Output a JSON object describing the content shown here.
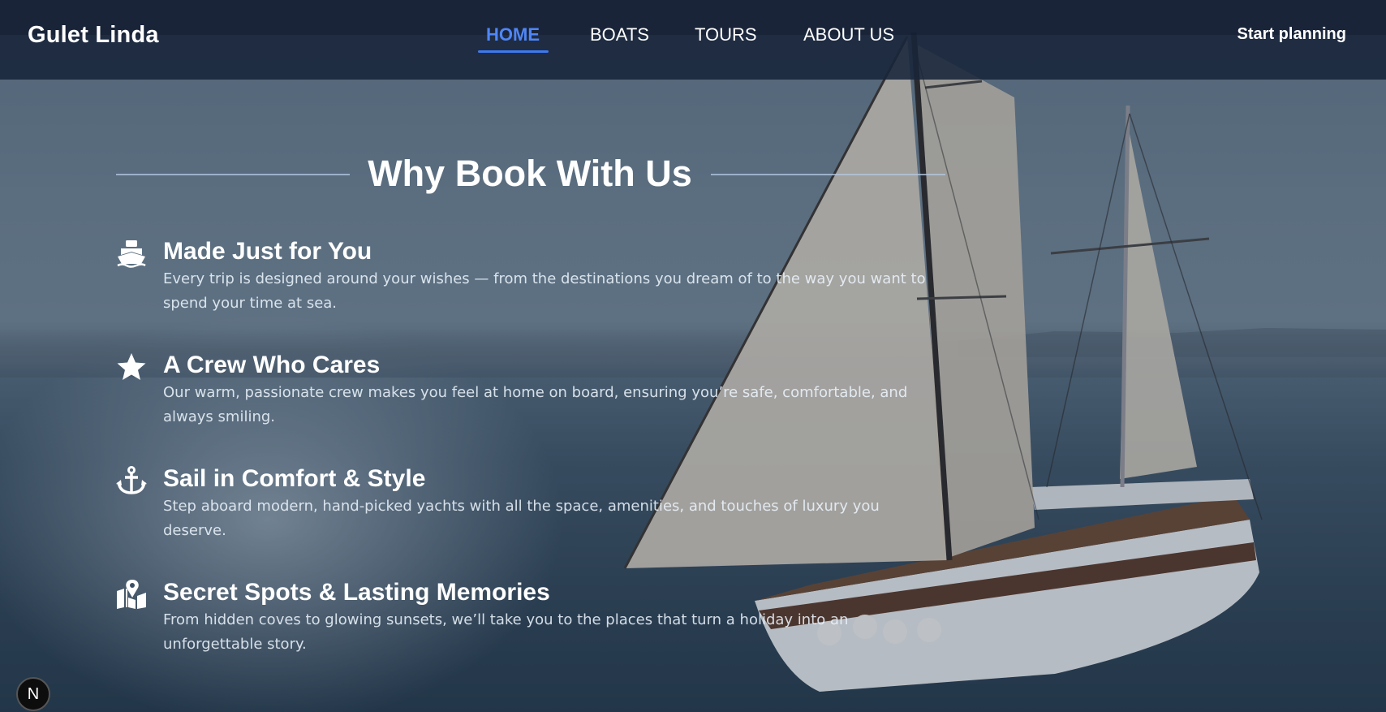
{
  "navbar": {
    "brand": "Gulet Linda",
    "links": [
      {
        "label": "HOME",
        "active": true
      },
      {
        "label": "BOATS",
        "active": false
      },
      {
        "label": "TOURS",
        "active": false
      },
      {
        "label": "ABOUT US",
        "active": false
      }
    ],
    "cta_label": "Start planning"
  },
  "section": {
    "title": "Why Book With Us",
    "features": [
      {
        "icon": "ship-icon",
        "title": "Made Just for You",
        "text": "Every trip is designed around your wishes — from the destinations you dream of to the way you want to spend your time at sea."
      },
      {
        "icon": "star-icon",
        "title": "A Crew Who Cares",
        "text": "Our warm, passionate crew makes you feel at home on board, ensuring you’re safe, comfortable, and always smiling."
      },
      {
        "icon": "anchor-icon",
        "title": "Sail in Comfort & Style",
        "text": "Step aboard modern, hand-picked yachts with all the space, amenities, and touches of luxury you deserve."
      },
      {
        "icon": "map-location-icon",
        "title": "Secret Spots & Lasting Memories",
        "text": "From hidden coves to glowing sunsets, we’ll take you to the places that turn a holiday into an unforgettable story."
      }
    ]
  },
  "dev_badge": {
    "label": "N"
  },
  "colors": {
    "nav_bg": "#18243a",
    "active_link": "#4f86f7",
    "text": "#ffffff"
  }
}
